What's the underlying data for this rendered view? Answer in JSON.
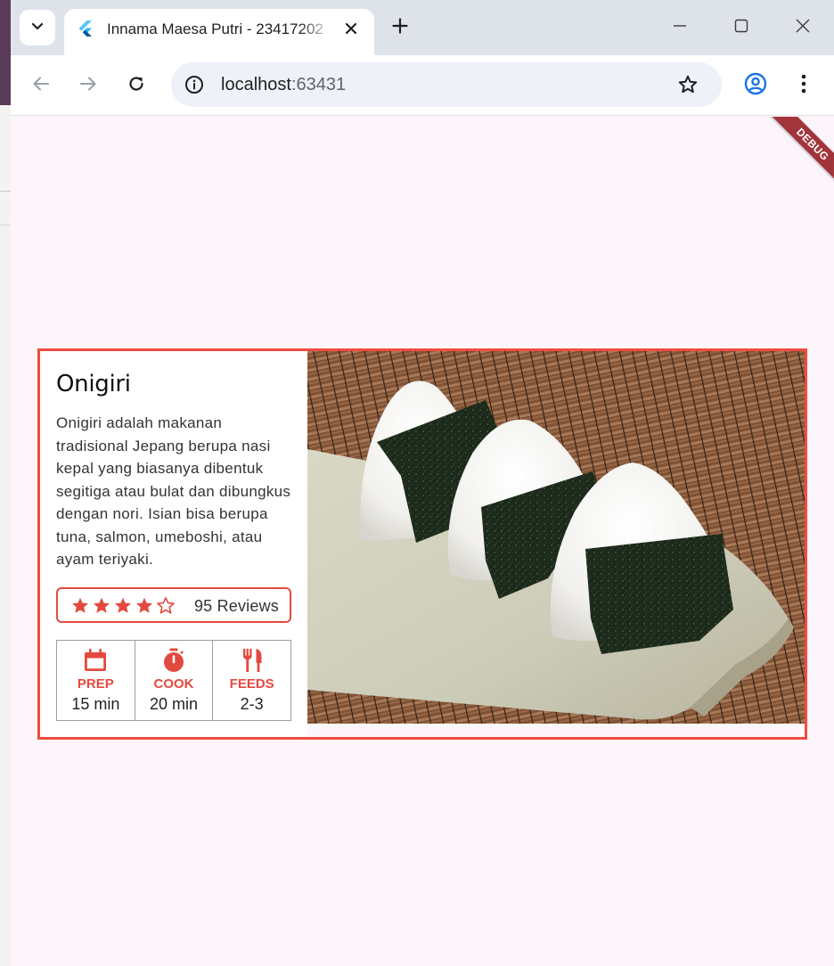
{
  "browser": {
    "tab_title": "Innama Maesa Putri - 23417202",
    "url_host": "localhost",
    "url_port": ":63431",
    "accent_color": "#1a73e8"
  },
  "app": {
    "debug_banner": "DEBUG",
    "accent_color": "#e34a3f",
    "recipe": {
      "title": "Onigiri",
      "description": "Onigiri adalah makanan tradisional Jepang berupa nasi kepal yang biasanya dibentuk segitiga atau bulat dan dibungkus dengan nori. Isian bisa berupa tuna, salmon, umeboshi, atau ayam teriyaki.",
      "rating": {
        "filled_stars": 4,
        "total_stars": 5,
        "reviews_label": "95 Reviews"
      },
      "stats": [
        {
          "icon": "calendar-icon",
          "label": "PREP",
          "value": "15 min"
        },
        {
          "icon": "timer-icon",
          "label": "COOK",
          "value": "20 min"
        },
        {
          "icon": "restaurant-icon",
          "label": "FEEDS",
          "value": "2-3"
        }
      ]
    }
  }
}
